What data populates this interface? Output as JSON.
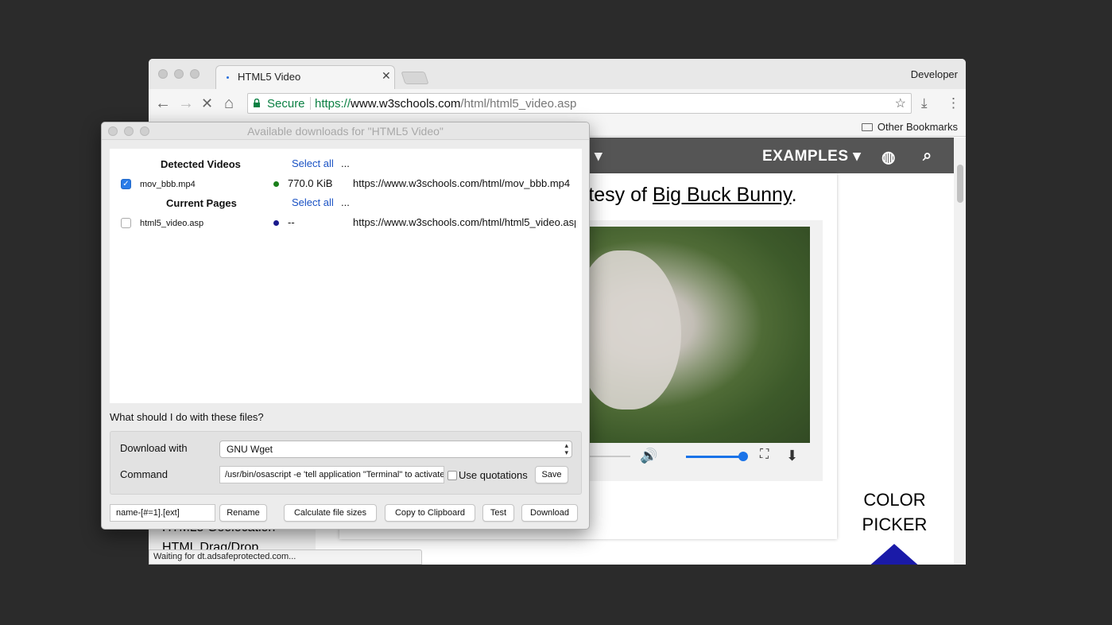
{
  "browser": {
    "tab_title": "HTML5 Video",
    "profile": "Developer",
    "secure_label": "Secure",
    "url_scheme": "https://",
    "url_host": "www.w3schools.com",
    "url_path": "/html/html5_video.asp",
    "other_bookmarks": "Other Bookmarks",
    "status": "Waiting for dt.adsafeprotected.com..."
  },
  "page": {
    "nav_partial": "E",
    "nav_examples": "EXAMPLES",
    "courtesy_prefix": "rtesy of ",
    "courtesy_link": "Big Buck Bunny",
    "courtesy_suffix": ".",
    "left_links": [
      "HTML5 Geolocation",
      "HTML Drag/Drop"
    ],
    "color_picker_line1": "COLOR",
    "color_picker_line2": "PICKER",
    "volume_level": 1.0
  },
  "dialog": {
    "title": "Available downloads for \"HTML5 Video\"",
    "groups": [
      {
        "header": "Detected Videos",
        "select_all": "Select all",
        "ellipsis": "...",
        "item": {
          "name": "mov_bbb.mp4",
          "checked": true,
          "size": "770.0 KiB",
          "url": "https://www.w3schools.com/html/mov_bbb.mp4",
          "dot_color": "#1a7f1a"
        }
      },
      {
        "header": "Current Pages",
        "select_all": "Select all",
        "ellipsis": "...",
        "item": {
          "name": "html5_video.asp",
          "checked": false,
          "size": "--",
          "url": "https://www.w3schools.com/html/html5_video.asp",
          "dot_color": "#1a1a8c"
        }
      }
    ],
    "question": "What should I do with these files?",
    "download_with_label": "Download with",
    "download_with_value": "GNU Wget",
    "command_label": "Command",
    "command_value": "/usr/bin/osascript -e 'tell application \"Terminal\" to activate'",
    "use_quotations": "Use quotations",
    "save": "Save",
    "rename_pattern": "name-[#=1].[ext]",
    "rename": "Rename",
    "calc_sizes": "Calculate file sizes",
    "copy_clipboard": "Copy to Clipboard",
    "test": "Test",
    "download": "Download"
  }
}
